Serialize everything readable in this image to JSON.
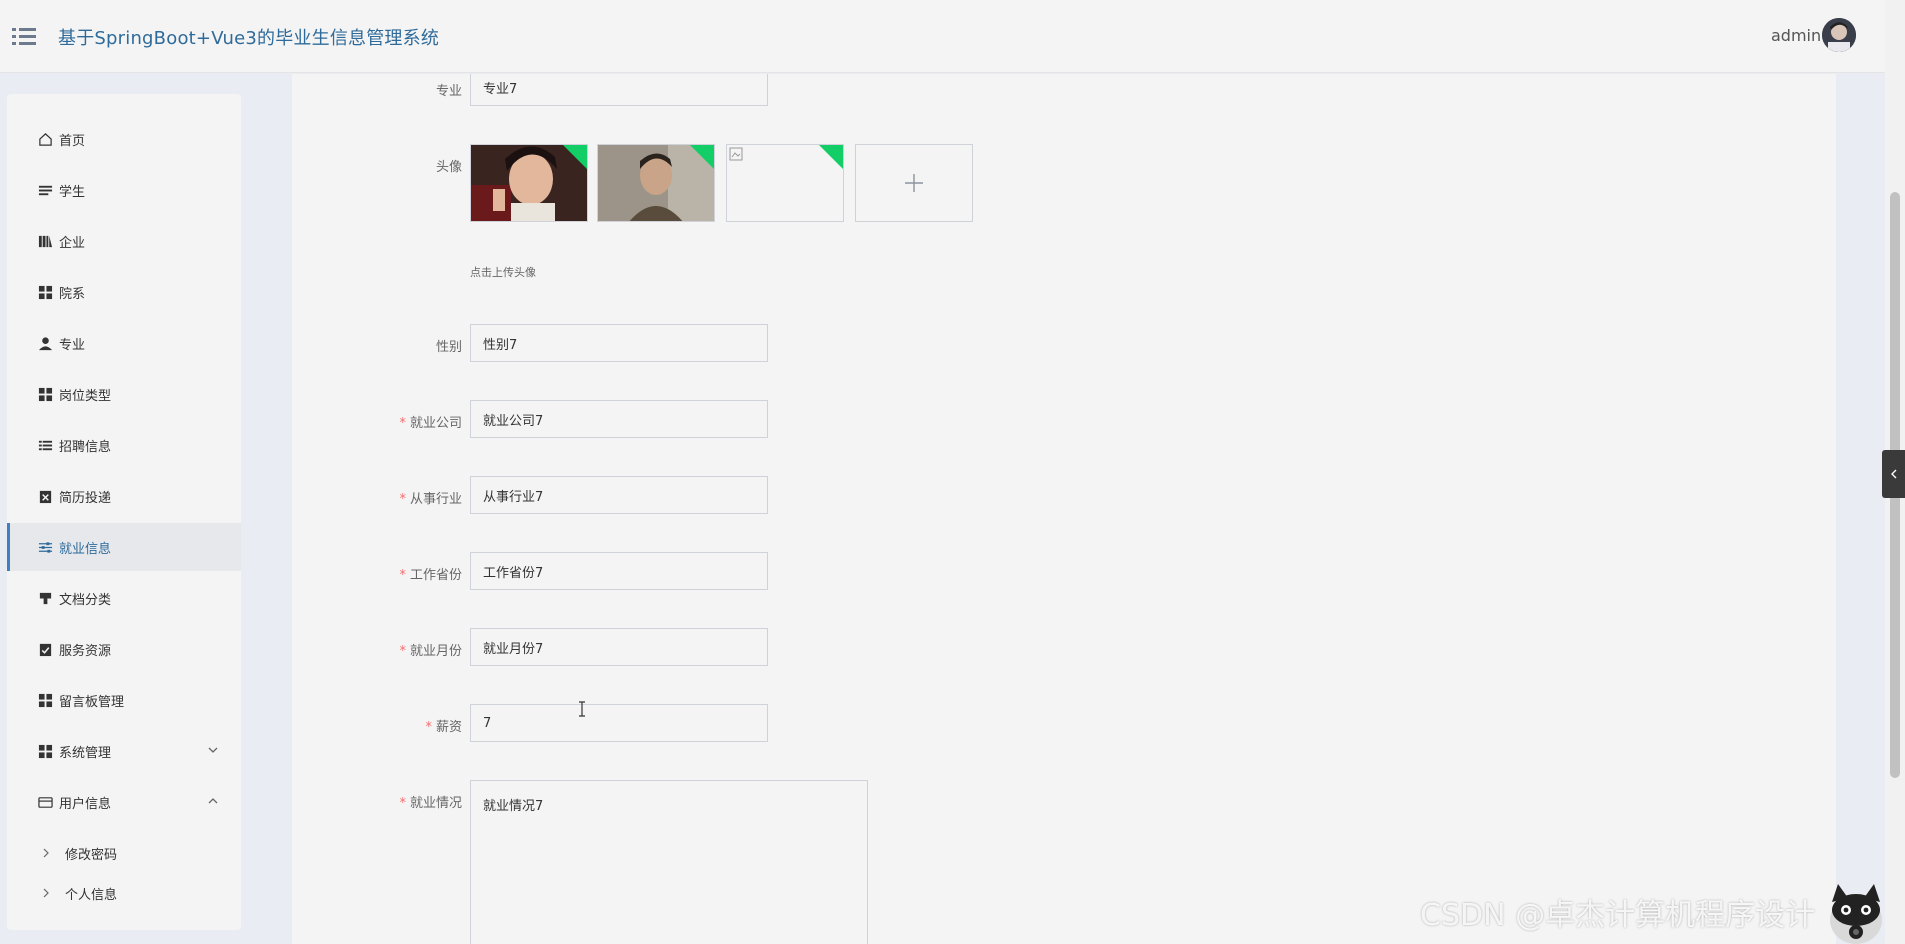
{
  "header": {
    "title": "基于SpringBoot+Vue3的毕业生信息管理系统",
    "username": "admin"
  },
  "sidebar": {
    "items": [
      {
        "label": "首页",
        "icon": "home-icon"
      },
      {
        "label": "学生",
        "icon": "list-icon"
      },
      {
        "label": "企业",
        "icon": "building-icon"
      },
      {
        "label": "院系",
        "icon": "grid-icon"
      },
      {
        "label": "专业",
        "icon": "user-icon"
      },
      {
        "label": "岗位类型",
        "icon": "grid-icon"
      },
      {
        "label": "招聘信息",
        "icon": "list-icon"
      },
      {
        "label": "简历投递",
        "icon": "clipboard-x-icon"
      },
      {
        "label": "就业信息",
        "icon": "sliders-icon",
        "active": true
      },
      {
        "label": "文档分类",
        "icon": "stamp-icon"
      },
      {
        "label": "服务资源",
        "icon": "clipboard-check-icon"
      },
      {
        "label": "留言板管理",
        "icon": "grid-icon"
      },
      {
        "label": "系统管理",
        "icon": "grid-icon",
        "expand": "chevron-down-icon"
      },
      {
        "label": "用户信息",
        "icon": "card-icon",
        "expand": "chevron-up-icon"
      }
    ],
    "sub_items": [
      {
        "label": "修改密码"
      },
      {
        "label": "个人信息"
      }
    ]
  },
  "form": {
    "major": {
      "label": "专业",
      "value": "专业7"
    },
    "avatar": {
      "label": "头像",
      "tip": "点击上传头像"
    },
    "gender": {
      "label": "性别",
      "value": "性别7"
    },
    "company": {
      "label": "就业公司",
      "value": "就业公司7",
      "required": "*"
    },
    "industry": {
      "label": "从事行业",
      "value": "从事行业7",
      "required": "*"
    },
    "province": {
      "label": "工作省份",
      "value": "工作省份7",
      "required": "*"
    },
    "month": {
      "label": "就业月份",
      "value": "就业月份7",
      "required": "*"
    },
    "salary": {
      "label": "薪资",
      "value": "7",
      "required": "*"
    },
    "status": {
      "label": "就业情况",
      "value": "就业情况7",
      "required": "*"
    }
  },
  "watermark": "CSDN @卓杰计算机程序设计",
  "colors": {
    "accent": "#2f6b9a",
    "active_border": "#3f7fc2",
    "required": "#f56c6c",
    "upload_ok": "#13ce66"
  }
}
